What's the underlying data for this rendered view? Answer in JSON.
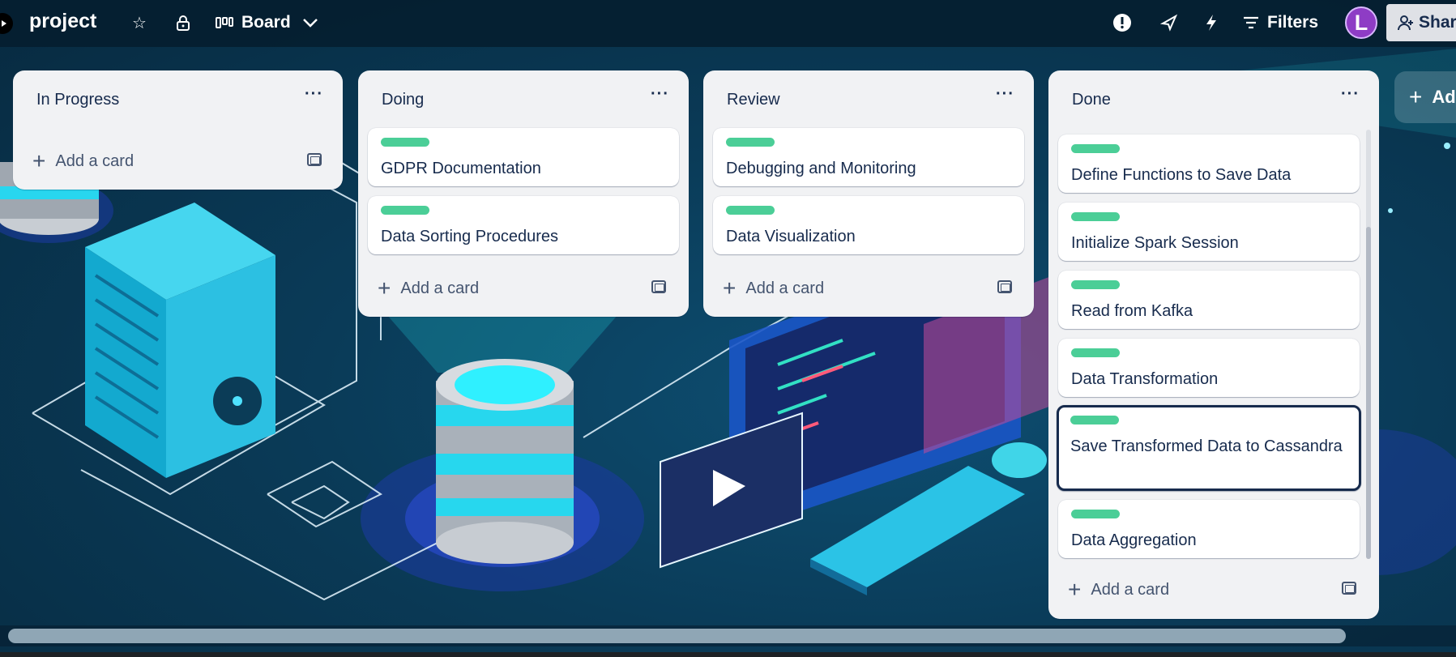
{
  "header": {
    "board_title": "project",
    "view_label": "Board",
    "filters_label": "Filters",
    "avatar_letter": "L",
    "share_label": "Share"
  },
  "lists": [
    {
      "title": "In Progress",
      "cards": [],
      "add_card_label": "Add a card"
    },
    {
      "title": "Doing",
      "cards": [
        "GDPR Documentation",
        "Data Sorting Procedures"
      ],
      "add_card_label": "Add a card"
    },
    {
      "title": "Review",
      "cards": [
        "Debugging and Monitoring",
        "Data Visualization"
      ],
      "add_card_label": "Add a card"
    },
    {
      "title": "Done",
      "cards": [
        "Define Functions to Save Data",
        "Initialize Spark Session",
        "Read from Kafka",
        "Data Transformation",
        "Save Transformed Data to Cassandra",
        "Data Aggregation"
      ],
      "add_card_label": "Add a card"
    }
  ],
  "add_list_label": "Ad",
  "colors": {
    "label_green": "#4bce97",
    "list_bg": "#f1f2f4",
    "avatar": "#8e3cc5"
  },
  "icons": [
    "star-icon",
    "lock-icon",
    "board-icon",
    "chevron-down-icon",
    "alert-icon",
    "rocket-icon",
    "lightning-icon",
    "filter-icon",
    "share-person-icon",
    "more-icon",
    "plus-icon",
    "card-template-icon"
  ]
}
